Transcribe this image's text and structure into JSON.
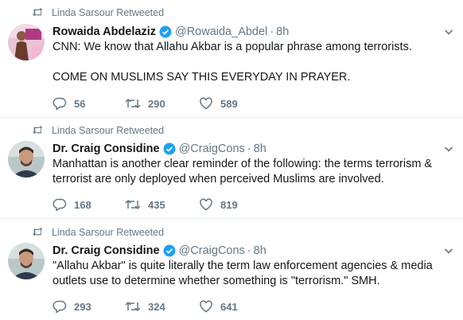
{
  "tweets": [
    {
      "retweeted_by": "Linda Sarsour Retweeted",
      "name": "Rowaida Abdelaziz",
      "handle": "@Rowaida_Abdel",
      "time": "8h",
      "avatar_icon": "avatar-photo-pink",
      "paragraphs": [
        "CNN: We know that Allahu Akbar is a popular phrase among terrorists.",
        "COME ON MUSLIMS SAY THIS EVERYDAY IN PRAYER."
      ],
      "replies": "56",
      "retweets": "290",
      "likes": "589"
    },
    {
      "retweeted_by": "Linda Sarsour Retweeted",
      "name": "Dr. Craig Considine",
      "handle": "@CraigCons",
      "time": "8h",
      "avatar_icon": "avatar-photo-man",
      "paragraphs": [
        "Manhattan is another clear reminder of the following: the terms terrorism & terrorist are only deployed when perceived Muslims are involved."
      ],
      "replies": "168",
      "retweets": "435",
      "likes": "819"
    },
    {
      "retweeted_by": "Linda Sarsour Retweeted",
      "name": "Dr. Craig Considine",
      "handle": "@CraigCons",
      "time": "8h",
      "avatar_icon": "avatar-photo-man",
      "paragraphs": [
        "\"Allahu Akbar\" is quite literally the term law enforcement agencies & media outlets use to determine whether something is \"terrorism.\" SMH."
      ],
      "replies": "293",
      "retweets": "324",
      "likes": "641"
    }
  ],
  "colors": {
    "text": "#14171a",
    "muted": "#657786",
    "verified": "#1da1f2",
    "divider": "#e6ecf0"
  }
}
